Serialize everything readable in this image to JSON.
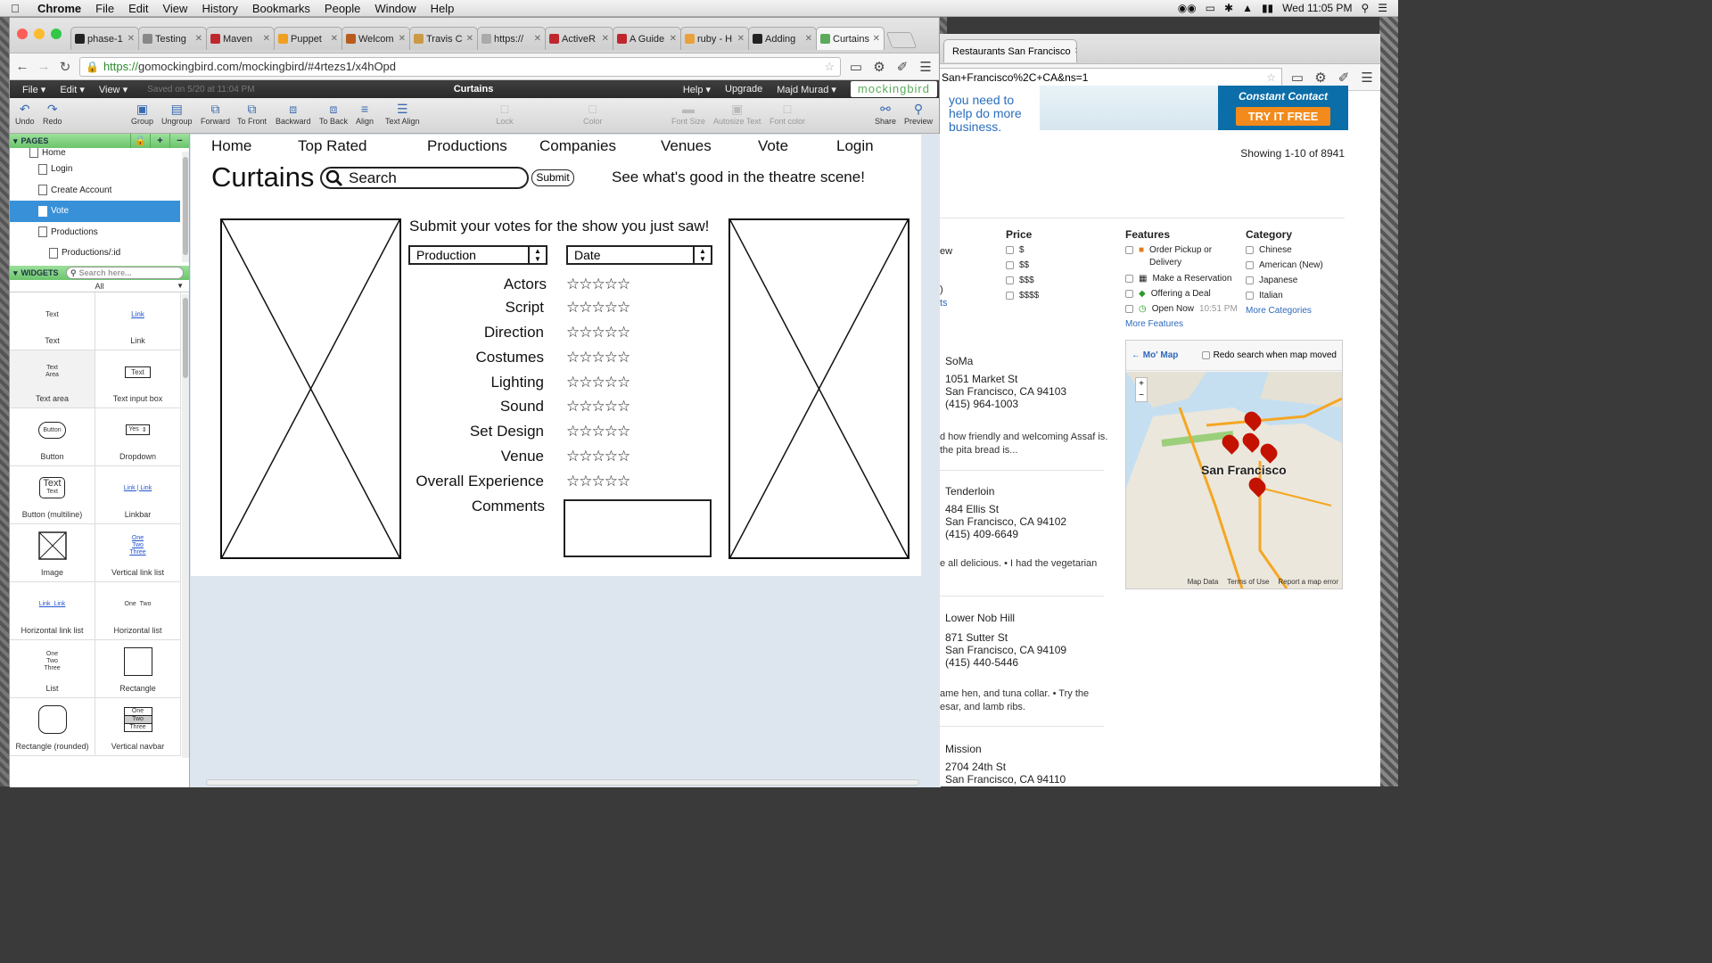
{
  "os": {
    "menu": [
      "Chrome",
      "File",
      "Edit",
      "View",
      "History",
      "Bookmarks",
      "People",
      "Window",
      "Help"
    ],
    "clock": "Wed 11:05 PM"
  },
  "browser": {
    "tabs": [
      {
        "label": "phase-1",
        "color": "#222"
      },
      {
        "label": "Testing",
        "color": "#888"
      },
      {
        "label": "Maven",
        "color": "#c0272d"
      },
      {
        "label": "Puppet",
        "color": "#f0a020"
      },
      {
        "label": "Welcom",
        "color": "#b85b1e"
      },
      {
        "label": "Travis C",
        "color": "#c94"
      },
      {
        "label": "https://",
        "color": "#aaa"
      },
      {
        "label": "ActiveR",
        "color": "#c0272d"
      },
      {
        "label": "A Guide",
        "color": "#c0272d"
      },
      {
        "label": "ruby - H",
        "color": "#e9a13b"
      },
      {
        "label": "Adding",
        "color": "#222"
      },
      {
        "label": "Curtains",
        "color": "#5aaa5a"
      }
    ],
    "url_https": "https://",
    "url_rest": "gomockingbird.com/mockingbird/#4rtezs1/x4hOpd"
  },
  "app": {
    "menus": [
      "File",
      "Edit",
      "View"
    ],
    "saved": "Saved on 5/20 at 11:04 PM",
    "title": "Curtains",
    "right": [
      "Help",
      "Upgrade",
      "Majd Murad"
    ],
    "brand": "mockingbird",
    "toolbar": {
      "undo": "Undo",
      "redo": "Redo",
      "group": "Group",
      "ungroup": "Ungroup",
      "forward": "Forward",
      "front": "To Front",
      "backward": "Backward",
      "back": "To Back",
      "align": "Align",
      "textalign": "Text Align",
      "lock": "Lock",
      "color": "Color",
      "fontsize": "Font Size",
      "autosize": "Autosize Text",
      "fontcolor": "Font color",
      "share": "Share",
      "preview": "Preview"
    }
  },
  "panel": {
    "pages_header": "PAGES",
    "pages": [
      "Home",
      "Login",
      "Create Account",
      "Vote",
      "Productions",
      "Productions/:id"
    ],
    "widgets_header": "WIDGETS",
    "widget_search": "Search here...",
    "filter": "All",
    "widgets": [
      "Text",
      "Link",
      "Text area",
      "Text input box",
      "Button",
      "Dropdown",
      "Button (multiline)",
      "Linkbar",
      "Image",
      "Vertical link list",
      "Horizontal link list",
      "Horizontal list",
      "List",
      "Rectangle",
      "Rectangle (rounded)",
      "Vertical navbar"
    ],
    "previews": {
      "text": "Text",
      "link": "Link",
      "textarea": "Text Area",
      "textinput": "Text",
      "button": "Button",
      "yes": "Yes",
      "multiline": "Text",
      "multiline2": "Text",
      "one": "One",
      "two": "Two",
      "three": "Three",
      "link2": "Link"
    }
  },
  "mockup": {
    "nav": [
      "Home",
      "Top Rated",
      "Productions",
      "Companies",
      "Venues",
      "Vote",
      "Login"
    ],
    "logo": "Curtains",
    "search": "Search",
    "submit": "Submit",
    "tagline": "See what's good in the theatre scene!",
    "heading": "Submit your votes for the show you just saw!",
    "dropdown_production": "Production",
    "dropdown_date": "Date",
    "criteria": [
      "Actors",
      "Script",
      "Direction",
      "Costumes",
      "Lighting",
      "Sound",
      "Set Design",
      "Venue",
      "Overall Experience"
    ],
    "stars": "☆☆☆☆☆",
    "comments": "Comments"
  },
  "yelp": {
    "tab": "Restaurants San Francisco",
    "url": "San+Francisco%2C+CA&ns=1",
    "ad_text": "you need to help do more business.",
    "ad_brand": "Constant Contact",
    "ad_cta": "TRY IT FREE",
    "showing": "Showing 1-10 of 8941",
    "price_h": "Price",
    "prices": [
      "$",
      "$$",
      "$$$",
      "$$$$"
    ],
    "features_h": "Features",
    "features": [
      "Order Pickup or",
      "Delivery",
      "Make a Reservation",
      "Offering a Deal",
      "Open Now",
      "10:51 PM"
    ],
    "more_features": "More Features",
    "category_h": "Category",
    "categories": [
      "Chinese",
      "American (New)",
      "Japanese",
      "Italian"
    ],
    "more_categories": "More Categories",
    "map_label": "Mo' Map",
    "redo": "Redo search when map moved",
    "map_city": "San Francisco",
    "map_footer": [
      "Map Data",
      "Terms of Use",
      "Report a map error"
    ],
    "cut_left": [
      "ew",
      ")",
      "ts"
    ],
    "results": [
      {
        "hood": "SoMa",
        "addr1": "1051 Market St",
        "addr2": "San Francisco, CA 94103",
        "phone": "(415) 964-1003",
        "snip1": "d how friendly and welcoming Assaf is.",
        "snip2": "the pita bread is..."
      },
      {
        "hood": "Tenderloin",
        "addr1": "484 Ellis St",
        "addr2": "San Francisco, CA 94102",
        "phone": "(415) 409-6649",
        "snip1": "e all delicious.  •  I had the vegetarian",
        "snip2": ""
      },
      {
        "hood": "Lower Nob Hill",
        "addr1": "871 Sutter St",
        "addr2": "San Francisco, CA 94109",
        "phone": "(415) 440-5446",
        "snip1": "ame hen, and tuna collar.  •  Try the",
        "snip2": "esar, and lamb ribs."
      },
      {
        "hood": "Mission",
        "addr1": "2704 24th St",
        "addr2": "San Francisco, CA 94110",
        "phone": "",
        "snip1": "",
        "snip2": ""
      }
    ]
  }
}
